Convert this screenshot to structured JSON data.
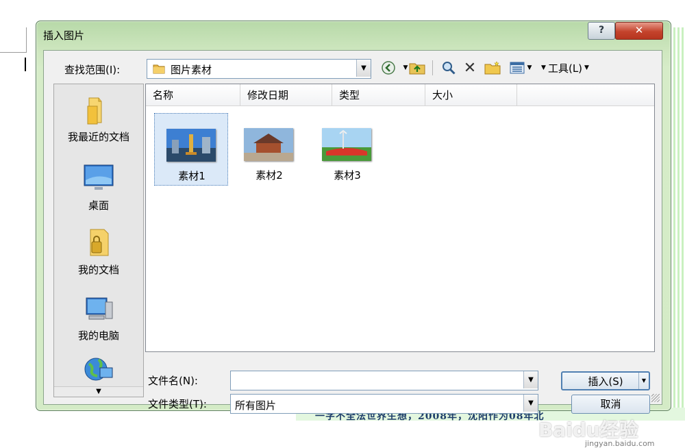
{
  "dialog": {
    "title": "插入图片",
    "help_glyph": "?",
    "close_glyph": "✕"
  },
  "lookin": {
    "label": "查找范围(I):",
    "value": "图片素材"
  },
  "toolbar": {
    "tools_label": "工具(L)"
  },
  "places": [
    {
      "label": "我最近的文档",
      "icon": "recent-documents-icon"
    },
    {
      "label": "桌面",
      "icon": "desktop-icon"
    },
    {
      "label": "我的文档",
      "icon": "my-documents-icon"
    },
    {
      "label": "我的电脑",
      "icon": "my-computer-icon"
    },
    {
      "label": "",
      "icon": "network-places-icon"
    }
  ],
  "columns": [
    "名称",
    "修改日期",
    "类型",
    "大小"
  ],
  "files": [
    {
      "name": "素材1",
      "selected": true
    },
    {
      "name": "素材2",
      "selected": false
    },
    {
      "name": "素材3",
      "selected": false
    }
  ],
  "form": {
    "filename_label": "文件名(N):",
    "filename_value": "",
    "filetype_label": "文件类型(T):",
    "filetype_value": "所有图片"
  },
  "buttons": {
    "insert": "插入(S)",
    "cancel": "取消"
  },
  "background": {
    "doc_text": "一字不全法世界生想，2008年，沈阳作为08年北"
  },
  "watermark": {
    "main": "Baidu经验",
    "sub": "jingyan.baidu.com"
  },
  "colors": {
    "frame": "#cfe7c0",
    "close": "#c4432c",
    "selection": "#dbe9f8"
  }
}
